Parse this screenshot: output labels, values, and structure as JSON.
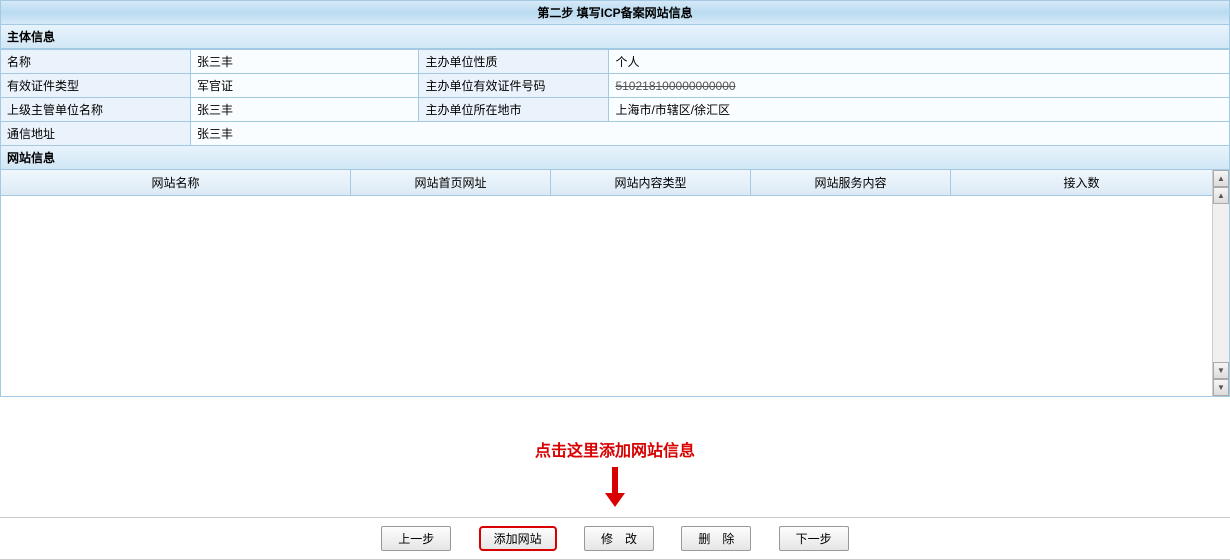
{
  "header": {
    "title": "第二步  填写ICP备案网站信息"
  },
  "subject_info": {
    "section_label": "主体信息",
    "rows": [
      {
        "l1": "名称",
        "v1": "张三丰",
        "l2": "主办单位性质",
        "v2": "个人"
      },
      {
        "l1": "有效证件类型",
        "v1": "军官证",
        "l2": "主办单位有效证件号码",
        "v2": "510218100000000000",
        "v2_struck": true
      },
      {
        "l1": "上级主管单位名称",
        "v1": "张三丰",
        "l2": "主办单位所在地市",
        "v2": "上海市/市辖区/徐汇区"
      },
      {
        "l1": "通信地址",
        "v1": "张三丰",
        "colspan": true
      }
    ]
  },
  "site_info": {
    "section_label": "网站信息",
    "columns": [
      "网站名称",
      "网站首页网址",
      "网站内容类型",
      "网站服务内容",
      "接入数"
    ]
  },
  "annotation": {
    "text": "点击这里添加网站信息"
  },
  "buttons": {
    "prev": "上一步",
    "add": "添加网站",
    "edit": "修　改",
    "delete": "删　除",
    "next": "下一步"
  }
}
